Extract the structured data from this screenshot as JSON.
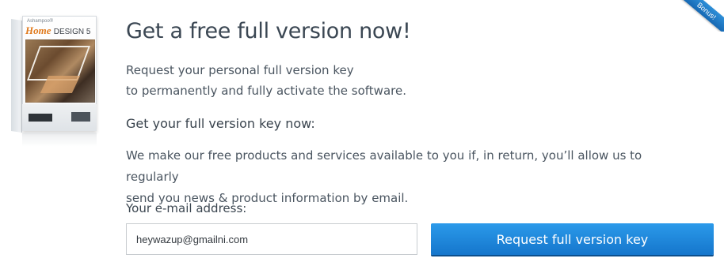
{
  "product": {
    "brand": "Ashampoo®",
    "name_script": "Home",
    "name_main": "DESIGN 5"
  },
  "ribbon": {
    "label": "Bonus!"
  },
  "headline": "Get a free full version now!",
  "intro": {
    "line1": "Request your personal full version key",
    "line2": "to permanently and fully activate the software."
  },
  "subhead": "Get your full version key now:",
  "body": {
    "line1": "We make our free products and services available to you if, in return, you’ll allow us to regularly",
    "line2": "send you news & product information by email."
  },
  "form": {
    "email_label": "Your e-mail address:",
    "email_value": "heywazup@gmailni.com",
    "submit_label": "Request full version key"
  },
  "colors": {
    "accent": "#1e86dd",
    "heading": "#3b4753",
    "text": "#4a5560"
  }
}
